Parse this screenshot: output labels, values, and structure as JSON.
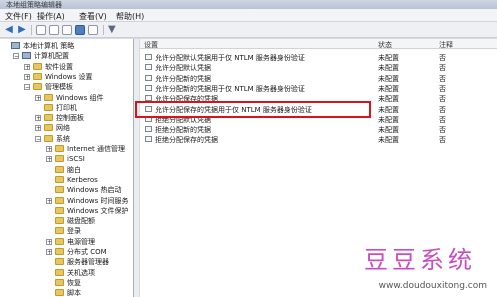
{
  "window": {
    "title": "本地组策略编辑器"
  },
  "menu": [
    "文件(F)",
    "操作(A)",
    "查看(V)",
    "帮助(H)"
  ],
  "tree": [
    {
      "label": "本地计算机 策略",
      "indent": 0,
      "type": "comp",
      "exp": ""
    },
    {
      "label": "计算机配置",
      "indent": 1,
      "type": "comp",
      "exp": "−"
    },
    {
      "label": "软件设置",
      "indent": 2,
      "type": "folder",
      "exp": "+"
    },
    {
      "label": "Windows 设置",
      "indent": 2,
      "type": "folder",
      "exp": "+"
    },
    {
      "label": "管理模板",
      "indent": 2,
      "type": "folder",
      "exp": "−"
    },
    {
      "label": "Windows 组件",
      "indent": 3,
      "type": "folder",
      "exp": "+"
    },
    {
      "label": "打印机",
      "indent": 3,
      "type": "folder",
      "exp": ""
    },
    {
      "label": "控制面板",
      "indent": 3,
      "type": "folder",
      "exp": "+"
    },
    {
      "label": "网络",
      "indent": 3,
      "type": "folder",
      "exp": "+"
    },
    {
      "label": "系统",
      "indent": 3,
      "type": "folder",
      "exp": "−"
    },
    {
      "label": "Internet 通信管理",
      "indent": 4,
      "type": "folder",
      "exp": "+"
    },
    {
      "label": "iSCSI",
      "indent": 4,
      "type": "folder",
      "exp": "+"
    },
    {
      "label": "脑白",
      "indent": 4,
      "type": "folder",
      "exp": ""
    },
    {
      "label": "Kerberos",
      "indent": 4,
      "type": "folder",
      "exp": ""
    },
    {
      "label": "Windows 热启动",
      "indent": 4,
      "type": "folder",
      "exp": ""
    },
    {
      "label": "Windows 时间服务",
      "indent": 4,
      "type": "folder",
      "exp": "+"
    },
    {
      "label": "Windows 文件保护",
      "indent": 4,
      "type": "folder",
      "exp": ""
    },
    {
      "label": "磁盘配额",
      "indent": 4,
      "type": "folder",
      "exp": ""
    },
    {
      "label": "登录",
      "indent": 4,
      "type": "folder",
      "exp": ""
    },
    {
      "label": "电源管理",
      "indent": 4,
      "type": "folder",
      "exp": "+"
    },
    {
      "label": "分布式 COM",
      "indent": 4,
      "type": "folder",
      "exp": "+"
    },
    {
      "label": "服务器管理器",
      "indent": 4,
      "type": "folder",
      "exp": ""
    },
    {
      "label": "关机选项",
      "indent": 4,
      "type": "folder",
      "exp": ""
    },
    {
      "label": "恢复",
      "indent": 4,
      "type": "folder",
      "exp": ""
    },
    {
      "label": "脚本",
      "indent": 4,
      "type": "folder",
      "exp": ""
    }
  ],
  "list": {
    "columns": [
      "设置",
      "状态",
      "注释"
    ],
    "rows": [
      {
        "name": "允许分配默认凭据用于仅 NTLM 服务器身份验证",
        "status": "未配置",
        "comment": "否"
      },
      {
        "name": "允许分配默认凭据",
        "status": "未配置",
        "comment": "否"
      },
      {
        "name": "允许分配新的凭据",
        "status": "未配置",
        "comment": "否"
      },
      {
        "name": "允许分配新的凭据用于仅 NTLM 服务器身份验证",
        "status": "未配置",
        "comment": "否"
      },
      {
        "name": "允许分配保存的凭据",
        "status": "未配置",
        "comment": "否"
      },
      {
        "name": "允许分配保存的凭据用于仅 NTLM 服务器身份验证",
        "status": "未配置",
        "comment": "否"
      },
      {
        "name": "拒绝分配默认凭据",
        "status": "未配置",
        "comment": "否"
      },
      {
        "name": "拒绝分配新的凭据",
        "status": "未配置",
        "comment": "否"
      },
      {
        "name": "拒绝分配保存的凭据",
        "status": "未配置",
        "comment": "否"
      }
    ]
  },
  "watermark": {
    "title": "豆豆系统",
    "url": "www.doudouxitong.com"
  }
}
